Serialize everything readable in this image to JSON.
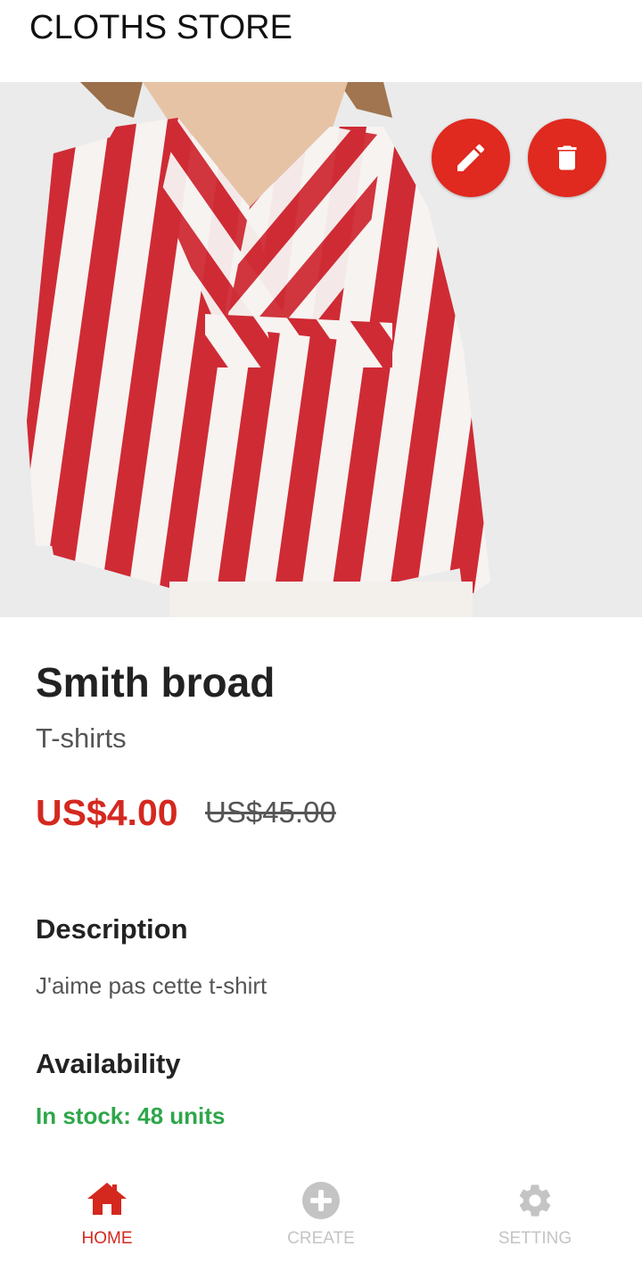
{
  "app": {
    "title": "CLOTHS STORE"
  },
  "product": {
    "name": "Smith broad",
    "category": "T-shirts",
    "price": "US$4.00",
    "original_price": "US$45.00",
    "description_title": "Description",
    "description": "J'aime pas cette t-shirt",
    "availability_title": "Availability",
    "stock": "In stock: 48 units"
  },
  "actions": {
    "edit_icon": "pencil-icon",
    "delete_icon": "trash-icon"
  },
  "nav": {
    "items": [
      {
        "label": "HOME",
        "icon": "home-icon",
        "active": true
      },
      {
        "label": "CREATE",
        "icon": "plus-circle-icon",
        "active": false
      },
      {
        "label": "SETTING",
        "icon": "gear-icon",
        "active": false
      }
    ]
  },
  "colors": {
    "accent": "#e0291f",
    "price": "#d4281f",
    "stock": "#2ea64a",
    "inactive": "#c4c4c4"
  }
}
